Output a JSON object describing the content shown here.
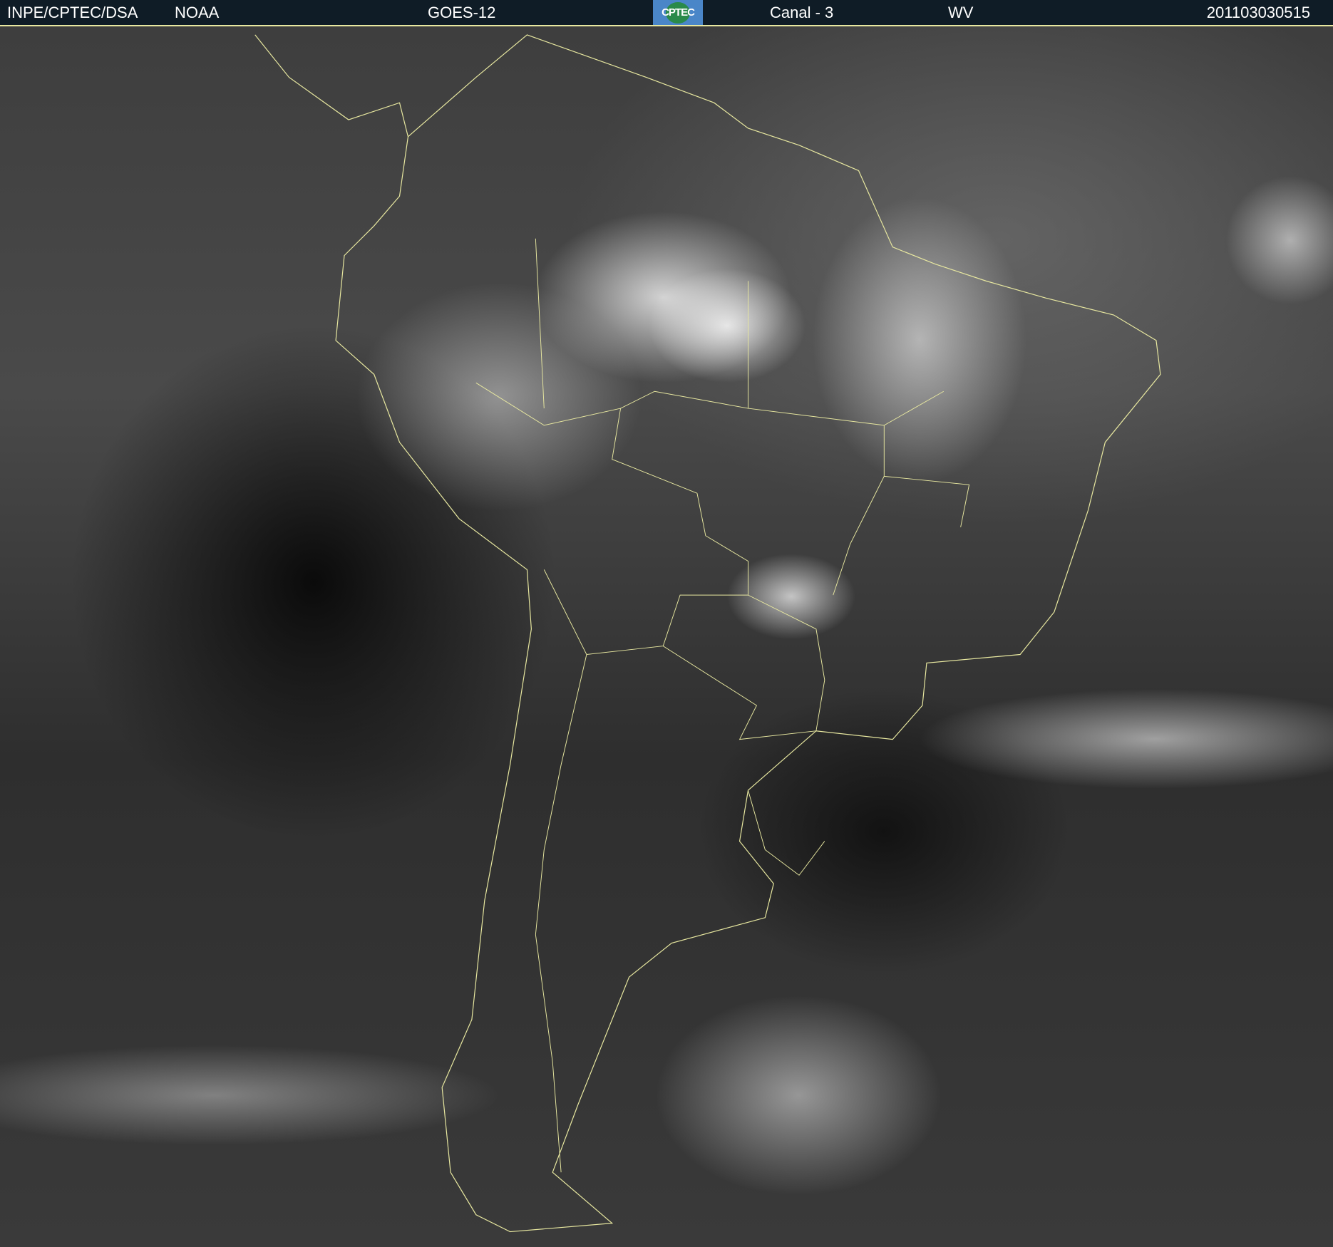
{
  "header": {
    "source": "INPE/CPTEC/DSA",
    "agency": "NOAA",
    "satellite": "GOES-12",
    "logo_text": "CPTEC",
    "channel": "Canal - 3",
    "band": "WV",
    "timestamp": "201103030515"
  },
  "colors": {
    "header_bg": "#0f1c26",
    "borders": "#e8e8a0"
  }
}
